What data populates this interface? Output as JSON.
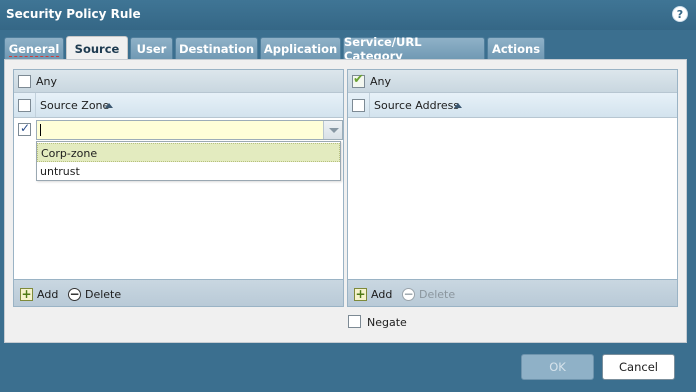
{
  "dialog": {
    "title": "Security Policy Rule",
    "help_icon": "question-circle-icon",
    "help_glyph": "?"
  },
  "tabs": [
    {
      "label": "General",
      "active": false
    },
    {
      "label": "Source",
      "active": true
    },
    {
      "label": "User",
      "active": false
    },
    {
      "label": "Destination",
      "active": false
    },
    {
      "label": "Application",
      "active": false
    },
    {
      "label": "Service/URL Category",
      "active": false
    },
    {
      "label": "Actions",
      "active": false
    }
  ],
  "source_zone": {
    "any_label": "Any",
    "any_checked": false,
    "column_header": "Source Zone",
    "input_value": "",
    "row_checked": true,
    "dropdown_options": [
      "Corp-zone",
      "untrust"
    ],
    "highlighted_option": "Corp-zone",
    "add_label": "Add",
    "delete_label": "Delete"
  },
  "source_address": {
    "any_label": "Any",
    "any_checked": true,
    "column_header": "Source Address",
    "add_label": "Add",
    "delete_label": "Delete",
    "delete_disabled": true
  },
  "negate": {
    "label": "Negate",
    "checked": false
  },
  "buttons": {
    "ok_label": "OK",
    "ok_disabled": true,
    "cancel_label": "Cancel"
  },
  "colors": {
    "title_bar": "#3b6f8f",
    "tab": "#7ea3bb",
    "checkmark_green": "#6aa132",
    "highlight": "#e3ebbf"
  }
}
